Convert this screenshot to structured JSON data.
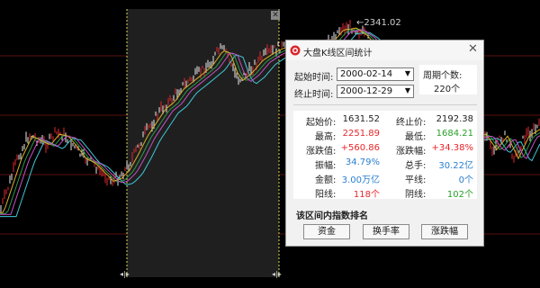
{
  "overlay": {
    "close_symbol": "✕"
  },
  "chart": {
    "peak_label": "2341.02",
    "handle_symbol": "◂|▸"
  },
  "colors": {
    "red_value": "#e8262a",
    "blue_value": "#2a7fd0",
    "green_value": "#27a02a",
    "red_bar": "#e0282f",
    "white_bar": "#e8e8e8",
    "ma_cyan": "#3fc8d6"
  },
  "dialog": {
    "title": "大盘K线区间统计",
    "close_symbol": "✕",
    "start_label": "起始时间:",
    "start_value": "2000-02-14",
    "end_label": "终止时间:",
    "end_value": "2000-12-29",
    "period_label": "周期个数:",
    "period_value": "220个",
    "stats": {
      "start_price_label": "起始价:",
      "start_price": "1631.52",
      "end_price_label": "终止价:",
      "end_price": "2192.38",
      "high_label": "最高:",
      "high": "2251.89",
      "low_label": "最低:",
      "low": "1684.21",
      "change_label": "涨跌值:",
      "change": "+560.86",
      "change_pct_label": "涨跌幅:",
      "change_pct": "+34.38%",
      "amplitude_label": "振幅:",
      "amplitude": "34.79%",
      "volume_label": "总手:",
      "volume": "30.22亿",
      "amount_label": "金额:",
      "amount": "3.00万亿",
      "flat_label": "平线:",
      "flat": "0个",
      "up_label": "阳线:",
      "up": "118个",
      "down_label": "阴线:",
      "down": "102个"
    },
    "section_title": "该区间内指数排名",
    "buttons": {
      "amount": "资金",
      "turnover": "换手率",
      "change": "涨跌幅"
    }
  }
}
